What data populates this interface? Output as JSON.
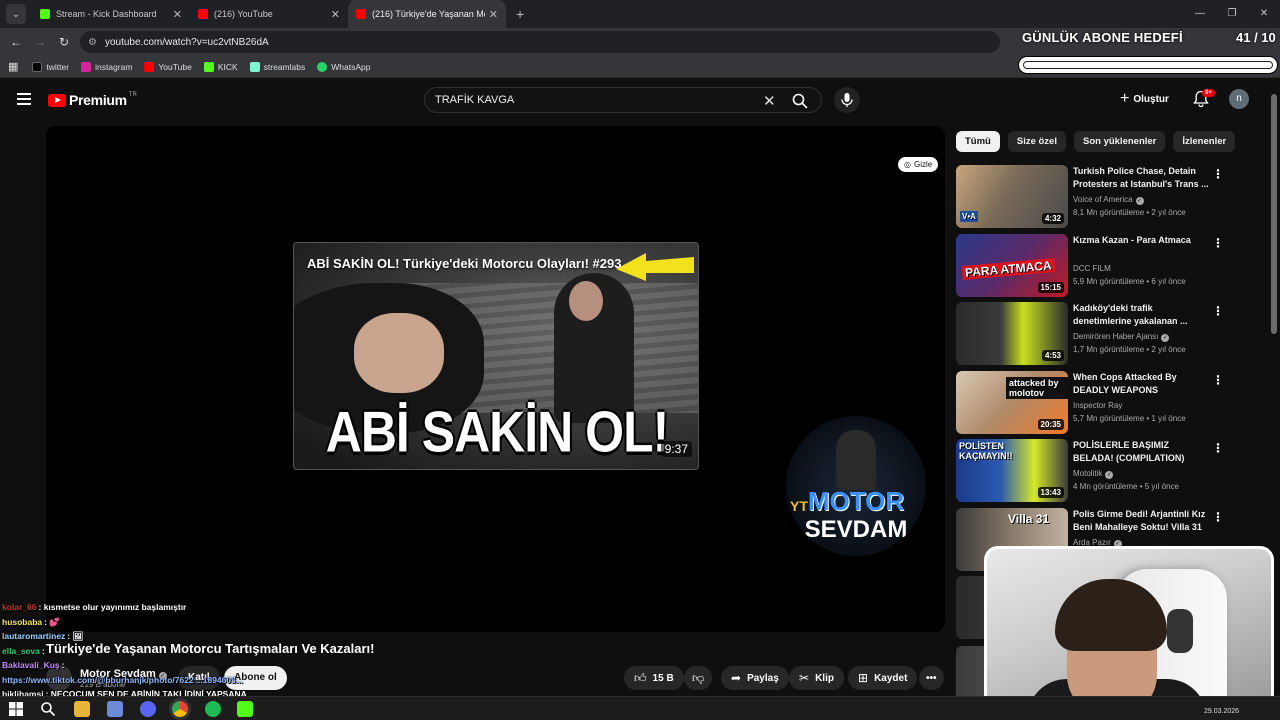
{
  "browser": {
    "tabs": [
      {
        "title": "Stream - Kick Dashboard",
        "color": "#53fc18"
      },
      {
        "title": "(216) YouTube",
        "color": "#ff0000"
      },
      {
        "title": "(216) Türkiye'de Yaşanan Motor",
        "color": "#ff0000"
      }
    ],
    "url": "youtube.com/watch?v=uc2vtNB26dA",
    "bookmarks": [
      {
        "label": "twitter",
        "color": "#000000"
      },
      {
        "label": "instagram",
        "color": "#d6249f"
      },
      {
        "label": "YouTube",
        "color": "#ff0000"
      },
      {
        "label": "KICK",
        "color": "#53fc18"
      },
      {
        "label": "streamlabs",
        "color": "#80f5d2"
      },
      {
        "label": "WhatsApp",
        "color": "#25d366"
      }
    ]
  },
  "goal": {
    "title": "GÜNLÜK ABONE HEDEFİ",
    "count": "41 / 10"
  },
  "youtube": {
    "logo": "Premium",
    "region": "TR",
    "search_value": "TRAFİK KAVGA",
    "create_label": "Oluştur",
    "notif_badge": "9+",
    "avatar_letter": "n"
  },
  "player": {
    "hide_label": "Gizle",
    "endcard_title": "ABİ SAKİN OL! Türkiye'deki Motorcu Olayları! #293",
    "endcard_big": "ABİ SAKİN OL!",
    "endcard_duration": "9:37",
    "channel_logo_yt": "YT",
    "channel_logo_top": "MOTOR",
    "channel_logo_bottom": "SEVDAM"
  },
  "video": {
    "title": "Türkiye'de Yaşanan Motorcu Tartışmaları Ve Kazaları!",
    "channel": "Motor Sevdam",
    "subs": "219 B abone",
    "join_label": "Katıl",
    "subscribe_label": "Abone ol",
    "likes": "15 B",
    "share_label": "Paylaş",
    "clip_label": "Klip",
    "save_label": "Kaydet"
  },
  "chips": [
    "Tümü",
    "Size özel",
    "Son yüklenenler",
    "İzlenenler"
  ],
  "recommendations": [
    {
      "title": "Turkish Police Chase, Detain Protesters at Istanbul's Trans ...",
      "channel": "Voice of America",
      "verified": true,
      "meta": "8,1 Mn görüntüleme • 2 yıl önce",
      "duration": "4:32",
      "caption": "",
      "thumb_colors": [
        "#c9a67d",
        "#4a4a4a"
      ]
    },
    {
      "title": "Kızma Kazan - Para Atmaca",
      "channel": "DCC FILM",
      "verified": false,
      "meta": "5,9 Mn görüntüleme • 6 yıl önce",
      "duration": "15:15",
      "caption": "PARA ATMACA",
      "thumb_colors": [
        "#c01a24",
        "#2a3a8a"
      ]
    },
    {
      "title": "Kadıköy'deki trafik denetimlerine yakalanan ...",
      "channel": "Demirören Haber Ajansı",
      "verified": true,
      "meta": "1,7 Mn görüntüleme • 2 yıl önce",
      "duration": "4:53",
      "caption": "",
      "thumb_colors": [
        "#2a2a2a",
        "#c8e020"
      ]
    },
    {
      "title": "When Cops Attacked By DEADLY WEAPONS",
      "channel": "Inspector Ray",
      "verified": false,
      "meta": "5,7 Mn görüntüleme • 1 yıl önce",
      "duration": "20:35",
      "caption": "attacked by molotov",
      "thumb_colors": [
        "#d9c9b5",
        "#f07a2a"
      ]
    },
    {
      "title": "POLİSLERLE BAŞIMIZ BELADA! (COMPILATION)",
      "channel": "Motolitik",
      "verified": true,
      "meta": "4 Mn görüntüleme • 5 yıl önce",
      "duration": "13:43",
      "caption": "POLİSTEN KAÇMAYIN!!",
      "thumb_colors": [
        "#1a3a8a",
        "#d6e82a"
      ]
    },
    {
      "title": "Polis Girme Dedi! Arjantinli Kız Beni Mahalleye Soktu! Villa 31",
      "channel": "Arda Pazır",
      "verified": true,
      "meta": "",
      "duration": "",
      "caption": "Villa 31",
      "thumb_colors": [
        "#8a7a6a",
        "#3a3a3a"
      ]
    }
  ],
  "chat": [
    {
      "user": "kolar_66",
      "color": "#c0392b",
      "msg": ": kısmetse olur yayınımız başlamıştır"
    },
    {
      "user": "husobaba",
      "color": "#f5e663",
      "msg": ": 💕"
    },
    {
      "user": "lautaromartinez",
      "color": "#9ad0ff",
      "msg": ": 🖼"
    },
    {
      "user": "ella_seva",
      "color": "#2ecc71",
      "msg": ": "
    },
    {
      "user": "Baklavali_Kuş",
      "color": "#c38bff",
      "msg": ":"
    },
    {
      "user": "https://www.tiktok.com/@bburhanjk/photo/7622",
      "color": "#8fb8ff",
      "msg": "...1894603..."
    },
    {
      "user": "bjklihamsi",
      "color": "#f0f0f0",
      "msg": ": NECOCUM SEN DE ABİNİN TAKLİDİNİ YAPSANA"
    }
  ],
  "taskbar": {
    "date": "29.03.2026"
  }
}
